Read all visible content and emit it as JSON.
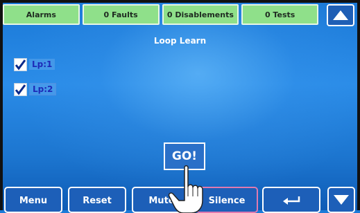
{
  "status_tabs": [
    "Alarms",
    "0 Faults",
    "0 Disablements",
    "0 Tests"
  ],
  "icons": {
    "up": "triangle-up-icon",
    "down": "triangle-down-icon",
    "return": "return-arrow-icon",
    "check": "checkmark-icon",
    "hand": "hand-pointer-icon"
  },
  "title": "Loop Learn",
  "loops": [
    {
      "label": "Lp:1",
      "checked": true
    },
    {
      "label": "Lp:2",
      "checked": true
    }
  ],
  "go_label": "GO!",
  "buttons": {
    "menu": "Menu",
    "reset": "Reset",
    "mute": "Mute",
    "silence": "Silence"
  },
  "colors": {
    "status_tab": "#8fe08a",
    "button_bg": "#1d5fb8",
    "loop_text": "#1d2bb8"
  }
}
